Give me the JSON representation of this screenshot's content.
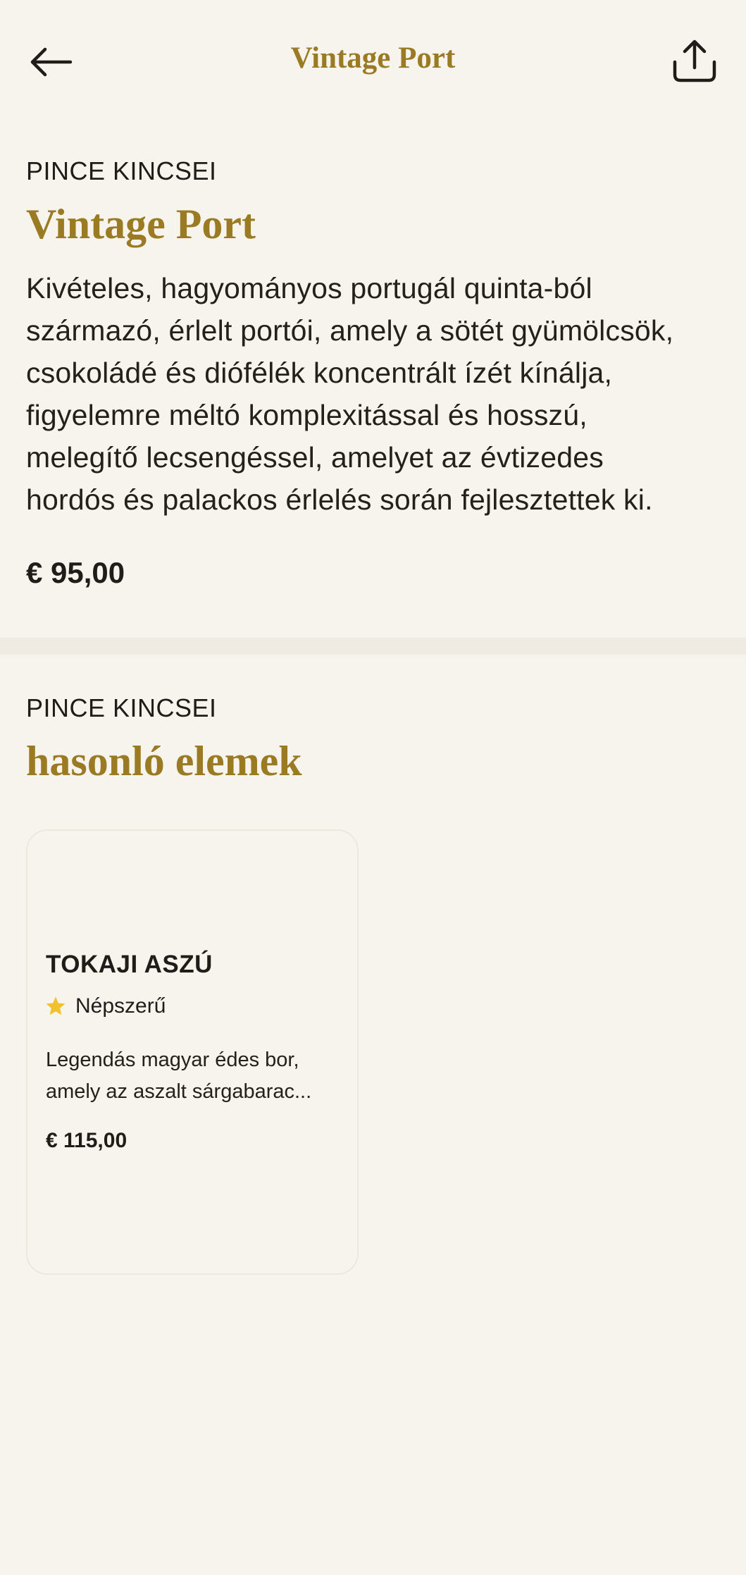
{
  "header": {
    "title": "Vintage Port",
    "back_icon": "arrow-left-icon",
    "share_icon": "share-icon"
  },
  "product": {
    "eyebrow": "PINCE KINCSEI",
    "name": "Vintage Port",
    "description_lines": [
      "Kivételes, hagyományos portugál quinta-ból",
      "származó, érlelt portói, amely a sötét gyümölcsök,",
      "csokoládé és diófélék koncentrált ízét kínálja,",
      "figyelemre méltó komplexitással és hosszú,",
      "melegítő lecsengéssel, amelyet az évtizedes",
      "hordós és palackos érlelés során fejlesztettek ki."
    ],
    "price": "€ 95,00"
  },
  "similar": {
    "eyebrow": "PINCE KINCSEI",
    "title": "hasonló elemek",
    "items": [
      {
        "name": "TOKAJI ASZÚ",
        "badge": "Népszerű",
        "badge_icon": "star-icon",
        "description_lines": [
          "Legendás magyar édes bor,",
          "amely az aszalt sárgabarac..."
        ],
        "price": "€ 115,00"
      }
    ]
  },
  "colors": {
    "background": "#f7f4ee",
    "accent_gold": "#9a7a22",
    "star": "#f2c12e",
    "text": "#1f1d1a"
  }
}
